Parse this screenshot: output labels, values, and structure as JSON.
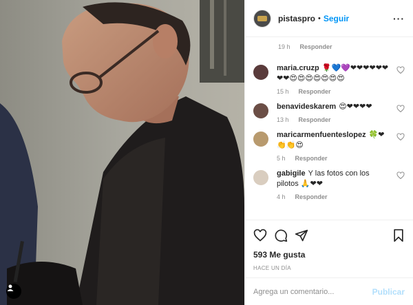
{
  "post": {
    "username": "pistaspro",
    "dot": "•",
    "follow_label": "Seguir",
    "more_label": "···"
  },
  "first_meta": {
    "time": "19 h",
    "reply": "Responder"
  },
  "comments": [
    {
      "user": "maria.cruzp",
      "text": "🌹💙💜❤❤❤❤❤❤❤❤😍😍😍😍😍😍😍",
      "time": "15 h",
      "reply": "Responder",
      "avatar_color": "#5a3b3b"
    },
    {
      "user": "benavideskarem",
      "text": "😍❤❤❤❤",
      "time": "13 h",
      "reply": "Responder",
      "avatar_color": "#6b4e46"
    },
    {
      "user": "maricarmenfuenteslopez",
      "text": "🍀❤👏👏😍",
      "time": "5 h",
      "reply": "Responder",
      "avatar_color": "#b89a6e"
    },
    {
      "user": "gabigile",
      "text": "Y las fotos con los pilotos 🙏❤❤",
      "time": "4 h",
      "reply": "Responder",
      "avatar_color": "#d9cdbf"
    }
  ],
  "likes": "593 Me gusta",
  "timestamp": "HACE UN DÍA",
  "add_comment": {
    "placeholder": "Agrega un comentario...",
    "post_label": "Publicar"
  },
  "colors": {
    "link": "#0095f6",
    "muted": "#8e8e8e",
    "post_disabled": "#b2dffc"
  }
}
